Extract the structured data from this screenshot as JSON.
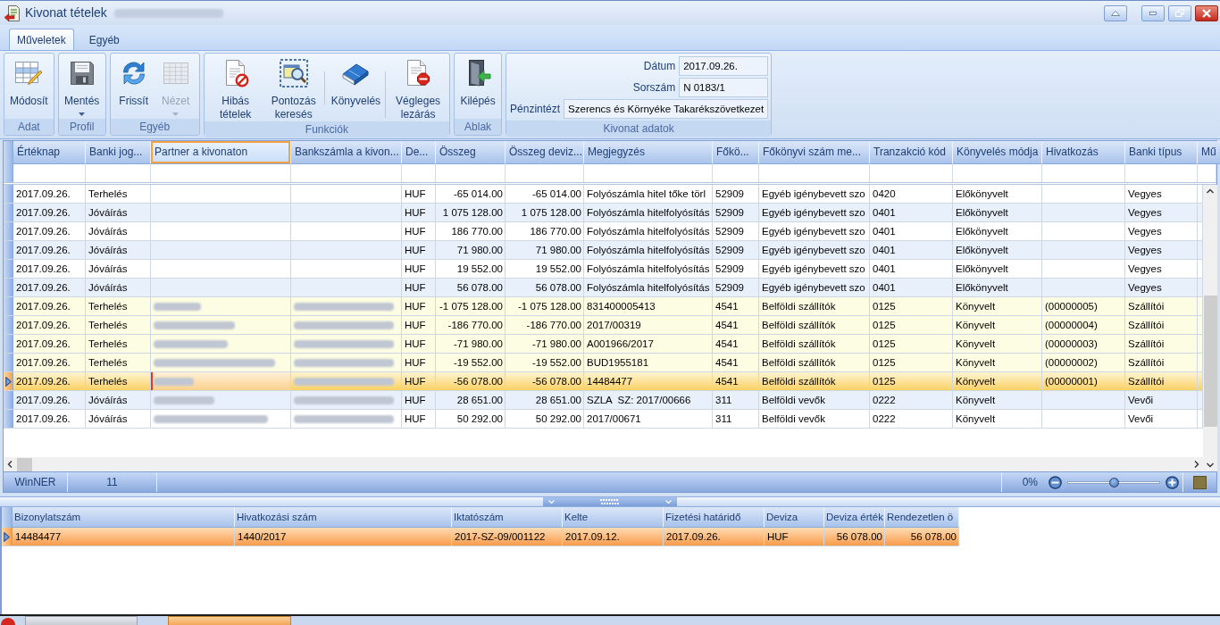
{
  "window": {
    "title": "Kivonat tételek",
    "title_note_redacted": true,
    "controls": [
      {
        "kind": "collapse"
      },
      {
        "kind": "minimize"
      },
      {
        "kind": "restore"
      },
      {
        "kind": "close"
      }
    ]
  },
  "tabs": [
    {
      "label": "Műveletek",
      "selected": true
    },
    {
      "label": "Egyéb",
      "selected": false
    }
  ],
  "ribbon": {
    "groups": [
      {
        "label": "Adat",
        "buttons": [
          {
            "label": "Módosít",
            "disabled": false,
            "dropdown": false,
            "separator_before": false
          }
        ]
      },
      {
        "label": "Profil",
        "buttons": [
          {
            "label": "Mentés",
            "disabled": false,
            "dropdown": true,
            "separator_before": false
          }
        ]
      },
      {
        "label": "Egyéb",
        "buttons": [
          {
            "label": "Frissít",
            "disabled": false,
            "dropdown": false,
            "separator_before": false
          },
          {
            "label": "Nézet",
            "disabled": true,
            "dropdown": true,
            "separator_before": false
          }
        ]
      },
      {
        "label": "Funkciók",
        "buttons": [
          {
            "label": "Hibás tételek",
            "disabled": false,
            "dropdown": false,
            "separator_before": false
          },
          {
            "label": "Pontozás keresés",
            "disabled": false,
            "dropdown": false,
            "separator_before": false
          },
          {
            "label": "Könyvelés",
            "disabled": false,
            "dropdown": false,
            "separator_before": true
          },
          {
            "label": "Végleges lezárás",
            "disabled": false,
            "dropdown": false,
            "separator_before": true
          }
        ]
      },
      {
        "label": "Ablak",
        "buttons": [
          {
            "label": "Kilépés",
            "disabled": false,
            "dropdown": false,
            "separator_before": false
          }
        ]
      }
    ],
    "statement_info": {
      "label": "Kivonat adatok",
      "fields": [
        {
          "label": "Dátum",
          "value": "2017.09.26."
        },
        {
          "label": "Sorszám",
          "value": "N 0183/1"
        },
        {
          "label": "Pénzintézt",
          "value": "Szerencs és Környéke Takarékszövetkezet"
        }
      ]
    }
  },
  "grid": {
    "columns": [
      {
        "label": "Értéknap",
        "selected": false
      },
      {
        "label": "Banki jog...",
        "selected": false
      },
      {
        "label": "Partner a kivonaton",
        "selected": true
      },
      {
        "label": "Bankszámla a kivon...",
        "selected": false
      },
      {
        "label": "De...",
        "selected": false
      },
      {
        "label": "Összeg",
        "selected": false
      },
      {
        "label": "Összeg deviz...",
        "selected": false
      },
      {
        "label": "Megjegyzés",
        "selected": false
      },
      {
        "label": "Főkö...",
        "selected": false
      },
      {
        "label": "Főkönyvi szám me...",
        "selected": false
      },
      {
        "label": "Tranzakció kód",
        "selected": false
      },
      {
        "label": "Könyvelés módja",
        "selected": false
      },
      {
        "label": "Hivatkozás",
        "selected": false
      },
      {
        "label": "Banki típus",
        "selected": false
      },
      {
        "label": "Mű",
        "selected": false
      }
    ],
    "rows": [
      {
        "date": "2017.09.26.",
        "entry_type": "Terhelés",
        "currency": "HUF",
        "amount": "-65 014.00",
        "amount_currency": "-65 014.00",
        "note": "Folyószámla hitel tőke törl",
        "ledger": "52909",
        "ledger_name": "Egyéb igénybevett szo",
        "transaction_code": "0420",
        "booking_mode": "Előkönyvelt",
        "bank_type": "Vegyes",
        "redacted": false,
        "highlighted": false,
        "selected": false
      },
      {
        "date": "2017.09.26.",
        "entry_type": "Jóváírás",
        "currency": "HUF",
        "amount": "1 075 128.00",
        "amount_currency": "1 075 128.00",
        "note": "Folyószámla hitelfolyósítás",
        "ledger": "52909",
        "ledger_name": "Egyéb igénybevett szo",
        "transaction_code": "0401",
        "booking_mode": "Előkönyvelt",
        "bank_type": "Vegyes",
        "redacted": false,
        "highlighted": false,
        "selected": false
      },
      {
        "date": "2017.09.26.",
        "entry_type": "Jóváírás",
        "currency": "HUF",
        "amount": "186 770.00",
        "amount_currency": "186 770.00",
        "note": "Folyószámla hitelfolyósítás",
        "ledger": "52909",
        "ledger_name": "Egyéb igénybevett szo",
        "transaction_code": "0401",
        "booking_mode": "Előkönyvelt",
        "bank_type": "Vegyes",
        "redacted": false,
        "highlighted": false,
        "selected": false
      },
      {
        "date": "2017.09.26.",
        "entry_type": "Jóváírás",
        "currency": "HUF",
        "amount": "71 980.00",
        "amount_currency": "71 980.00",
        "note": "Folyószámla hitelfolyósítás",
        "ledger": "52909",
        "ledger_name": "Egyéb igénybevett szo",
        "transaction_code": "0401",
        "booking_mode": "Előkönyvelt",
        "bank_type": "Vegyes",
        "redacted": false,
        "highlighted": false,
        "selected": false
      },
      {
        "date": "2017.09.26.",
        "entry_type": "Jóváírás",
        "currency": "HUF",
        "amount": "19 552.00",
        "amount_currency": "19 552.00",
        "note": "Folyószámla hitelfolyósítás",
        "ledger": "52909",
        "ledger_name": "Egyéb igénybevett szo",
        "transaction_code": "0401",
        "booking_mode": "Előkönyvelt",
        "bank_type": "Vegyes",
        "redacted": false,
        "highlighted": false,
        "selected": false
      },
      {
        "date": "2017.09.26.",
        "entry_type": "Jóváírás",
        "currency": "HUF",
        "amount": "56 078.00",
        "amount_currency": "56 078.00",
        "note": "Folyószámla hitelfolyósítás",
        "ledger": "52909",
        "ledger_name": "Egyéb igénybevett szo",
        "transaction_code": "0401",
        "booking_mode": "Előkönyvelt",
        "bank_type": "Vegyes",
        "redacted": false,
        "highlighted": false,
        "selected": false
      },
      {
        "date": "2017.09.26.",
        "entry_type": "Terhelés",
        "currency": "HUF",
        "amount": "-1 075 128.00",
        "amount_currency": "-1 075 128.00",
        "note": "831400005413",
        "ledger": "4541",
        "ledger_name": "Belföldi szállítók",
        "transaction_code": "0125",
        "booking_mode": "Könyvelt",
        "reference": "(00000005)",
        "bank_type": "Szállítói",
        "redacted": true,
        "highlighted": true,
        "selected": false
      },
      {
        "date": "2017.09.26.",
        "entry_type": "Terhelés",
        "currency": "HUF",
        "amount": "-186 770.00",
        "amount_currency": "-186 770.00",
        "note": "2017/00319",
        "ledger": "4541",
        "ledger_name": "Belföldi szállítók",
        "transaction_code": "0125",
        "booking_mode": "Könyvelt",
        "reference": "(00000004)",
        "bank_type": "Szállítói",
        "redacted": true,
        "highlighted": true,
        "selected": false
      },
      {
        "date": "2017.09.26.",
        "entry_type": "Terhelés",
        "currency": "HUF",
        "amount": "-71 980.00",
        "amount_currency": "-71 980.00",
        "note": "A001966/2017",
        "ledger": "4541",
        "ledger_name": "Belföldi szállítók",
        "transaction_code": "0125",
        "booking_mode": "Könyvelt",
        "reference": "(00000003)",
        "bank_type": "Szállítói",
        "redacted": true,
        "highlighted": true,
        "selected": false
      },
      {
        "date": "2017.09.26.",
        "entry_type": "Terhelés",
        "currency": "HUF",
        "amount": "-19 552.00",
        "amount_currency": "-19 552.00",
        "note": "BUD1955181",
        "ledger": "4541",
        "ledger_name": "Belföldi szállítók",
        "transaction_code": "0125",
        "booking_mode": "Könyvelt",
        "reference": "(00000002)",
        "bank_type": "Szállítói",
        "redacted": true,
        "highlighted": true,
        "selected": false
      },
      {
        "date": "2017.09.26.",
        "entry_type": "Terhelés",
        "currency": "HUF",
        "amount": "-56 078.00",
        "amount_currency": "-56 078.00",
        "note": "14484477",
        "ledger": "4541",
        "ledger_name": "Belföldi szállítók",
        "transaction_code": "0125",
        "booking_mode": "Könyvelt",
        "reference": "(00000001)",
        "bank_type": "Szállítói",
        "redacted": true,
        "highlighted": true,
        "selected": true
      },
      {
        "date": "2017.09.26.",
        "entry_type": "Jóváírás",
        "currency": "HUF",
        "amount": "28 651.00",
        "amount_currency": "28 651.00",
        "note": "SZLA  SZ: 2017/00666",
        "ledger": "311",
        "ledger_name": "Belföldi vevők",
        "transaction_code": "0222",
        "booking_mode": "Könyvelt",
        "bank_type": "Vevői",
        "redacted": true,
        "highlighted": false,
        "selected": false
      },
      {
        "date": "2017.09.26.",
        "entry_type": "Jóváírás",
        "currency": "HUF",
        "amount": "50 292.00",
        "amount_currency": "50 292.00",
        "note": "2017/00671",
        "ledger": "311",
        "ledger_name": "Belföldi vevők",
        "transaction_code": "0222",
        "booking_mode": "Könyvelt",
        "bank_type": "Vevői",
        "redacted": true,
        "highlighted": false,
        "selected": false
      }
    ],
    "status": {
      "source": "WinNER",
      "count": "11",
      "progress": "0%",
      "zoom": {
        "level": 0.5
      }
    }
  },
  "details": {
    "columns": [
      "Bizonylatszám",
      "Hivatkozási szám",
      "Iktatószám",
      "Kelte",
      "Fizetési határidő",
      "Deviza",
      "Deviza érték",
      "Rendezetlen ö"
    ],
    "rows": [
      {
        "cells": [
          "14484477",
          "1440/2017",
          "2017-SZ-09/001122",
          "2017.09.12.",
          "2017.09.26.",
          "HUF",
          "56 078.00",
          "56 078.00"
        ],
        "selected": true
      }
    ]
  }
}
